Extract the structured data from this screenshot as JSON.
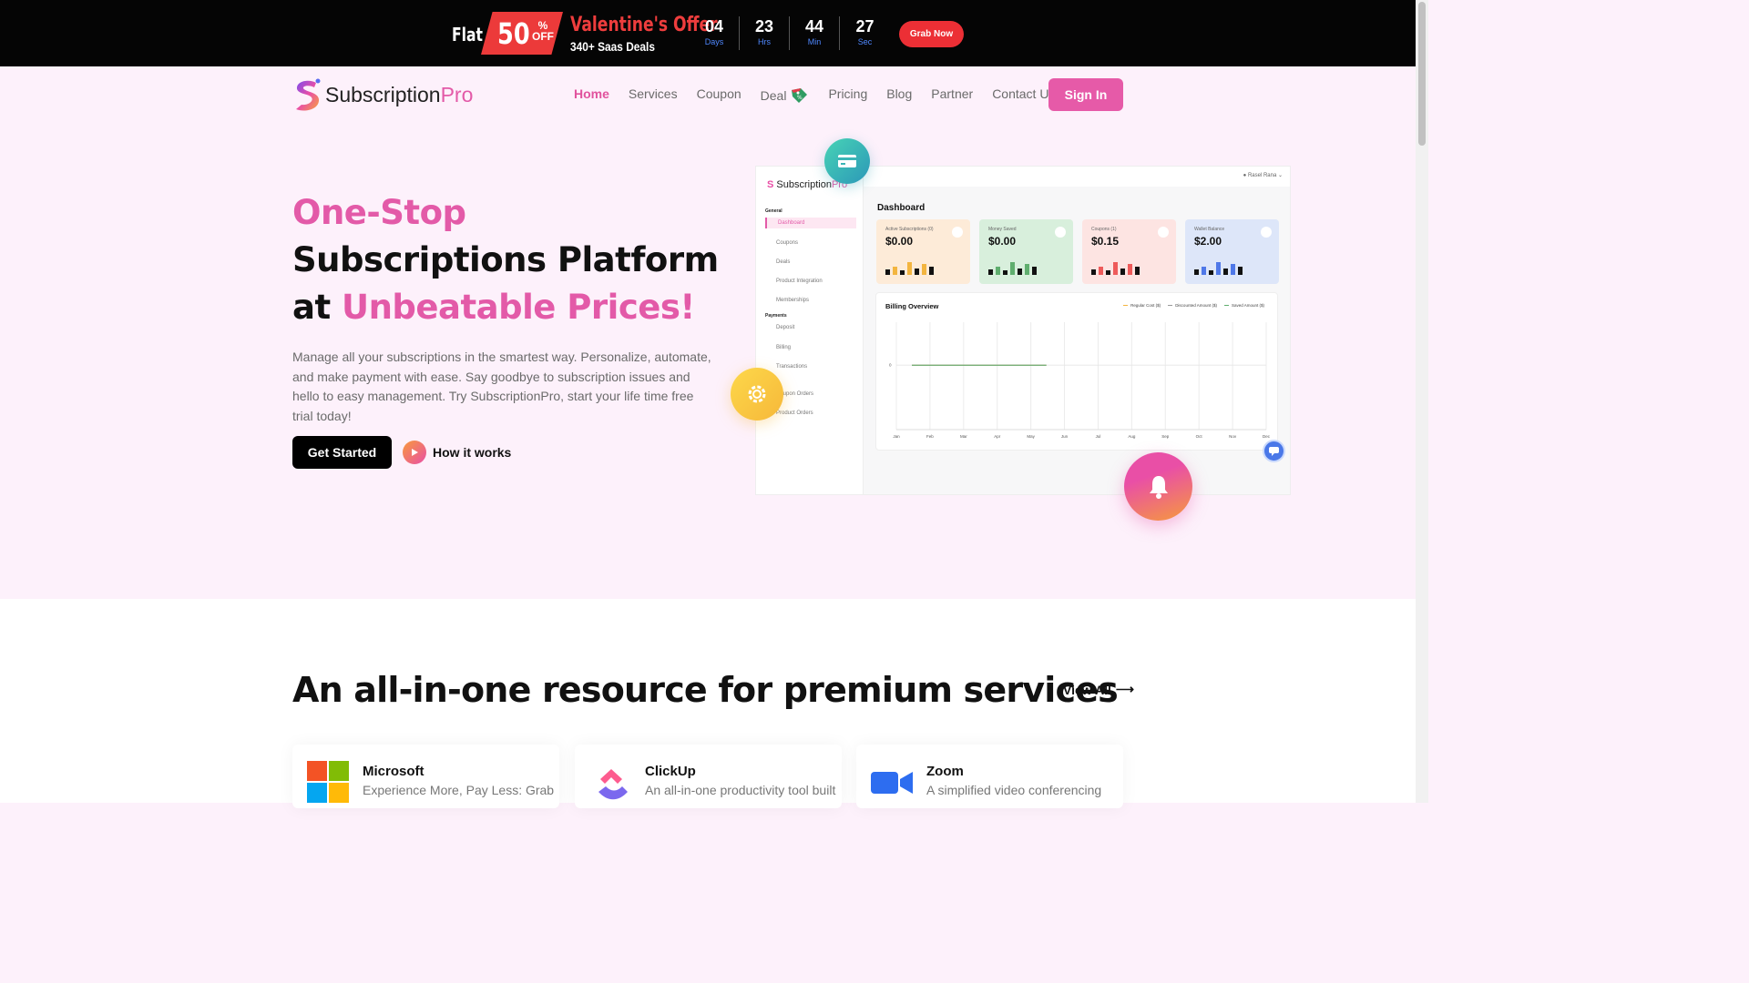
{
  "promo": {
    "flat": "Flat",
    "discount": "50",
    "percent": "%",
    "off": "OFF",
    "title": "Valentine's Offer",
    "subtitle": "340+ Saas Deals",
    "countdown": [
      {
        "value": "04",
        "unit": "Days"
      },
      {
        "value": "23",
        "unit": "Hrs"
      },
      {
        "value": "44",
        "unit": "Min"
      },
      {
        "value": "27",
        "unit": "Sec"
      }
    ],
    "cta": "Grab Now"
  },
  "brand": {
    "name_main": "Subscription",
    "name_accent": "Pro"
  },
  "nav": {
    "items": [
      "Home",
      "Services",
      "Coupon",
      "Deal",
      "Pricing",
      "Blog",
      "Partner",
      "Contact Us"
    ],
    "active": "Home",
    "signin": "Sign In"
  },
  "hero": {
    "title_pink_1": "One-Stop",
    "title_dark_1": " Subscriptions Platform at ",
    "title_pink_2": "Unbeatable Prices!",
    "description": "Manage all your subscriptions in the smartest way. Personalize, automate, and make payment with ease. Say goodbye to subscription issues and hello to easy management. Try SubscriptionPro, start your life time free trial today!",
    "primary_cta": "Get Started",
    "secondary_cta": "How it works"
  },
  "dashboard": {
    "user": "Rasel Rana",
    "logo_main": "Subscription",
    "logo_accent": "Pro",
    "sections": {
      "general": "General",
      "payments": "Payments"
    },
    "menu": [
      "Dashboard",
      "Coupons",
      "Deals",
      "Product Integration",
      "Memberships",
      "Deposit",
      "Billing",
      "Transactions",
      "Coupon Orders",
      "Product Orders"
    ],
    "title": "Dashboard",
    "cards": [
      {
        "label": "Active Subscriptions (0)",
        "value": "$0.00",
        "bg": "#fdebd8",
        "bar": "#f3b53f"
      },
      {
        "label": "Money Saved",
        "value": "$0.00",
        "bg": "#d8efdc",
        "bar": "#5fae6e"
      },
      {
        "label": "Coupons (1)",
        "value": "$0.15",
        "bg": "#fde4e2",
        "bar": "#ee5a5a"
      },
      {
        "label": "Wallet Balance",
        "value": "$2.00",
        "bg": "#dde6f9",
        "bar": "#4f78e8"
      }
    ],
    "billing_title": "Billing Overview",
    "legend": [
      "Regular Cost ($)",
      "Discounted Amount ($)",
      "Saved Amount ($)"
    ],
    "legend_colors": [
      "#f3b53f",
      "#999999",
      "#5fae6e"
    ]
  },
  "chart_data": {
    "type": "line",
    "title": "Billing Overview",
    "categories": [
      "Jan",
      "Feb",
      "Mar",
      "Apr",
      "May",
      "Jun",
      "Jul",
      "Aug",
      "Sep",
      "Oct",
      "Nov",
      "Dec"
    ],
    "series": [
      {
        "name": "Regular Cost ($)",
        "values": [
          0,
          0,
          0,
          0,
          0,
          null,
          null,
          null,
          null,
          null,
          null,
          null
        ]
      },
      {
        "name": "Discounted Amount ($)",
        "values": [
          0,
          0,
          0,
          0,
          0,
          null,
          null,
          null,
          null,
          null,
          null,
          null
        ]
      },
      {
        "name": "Saved Amount ($)",
        "values": [
          0,
          0,
          0,
          0,
          0,
          null,
          null,
          null,
          null,
          null,
          null,
          null
        ]
      }
    ],
    "yticks": [
      "0"
    ],
    "grid": true,
    "legend": "top-right"
  },
  "resources": {
    "title": "An all-in-one resource for premium services",
    "view_all": "View All",
    "services": [
      {
        "name": "Microsoft",
        "desc": "Experience More, Pay Less: Grab"
      },
      {
        "name": "ClickUp",
        "desc": "An all-in-one productivity tool built"
      },
      {
        "name": "Zoom",
        "desc": "A simplified video conferencing"
      }
    ]
  },
  "colors": {
    "accent": "#e35aa8",
    "promo_red": "#ec3a3a",
    "dark": "#000000"
  }
}
